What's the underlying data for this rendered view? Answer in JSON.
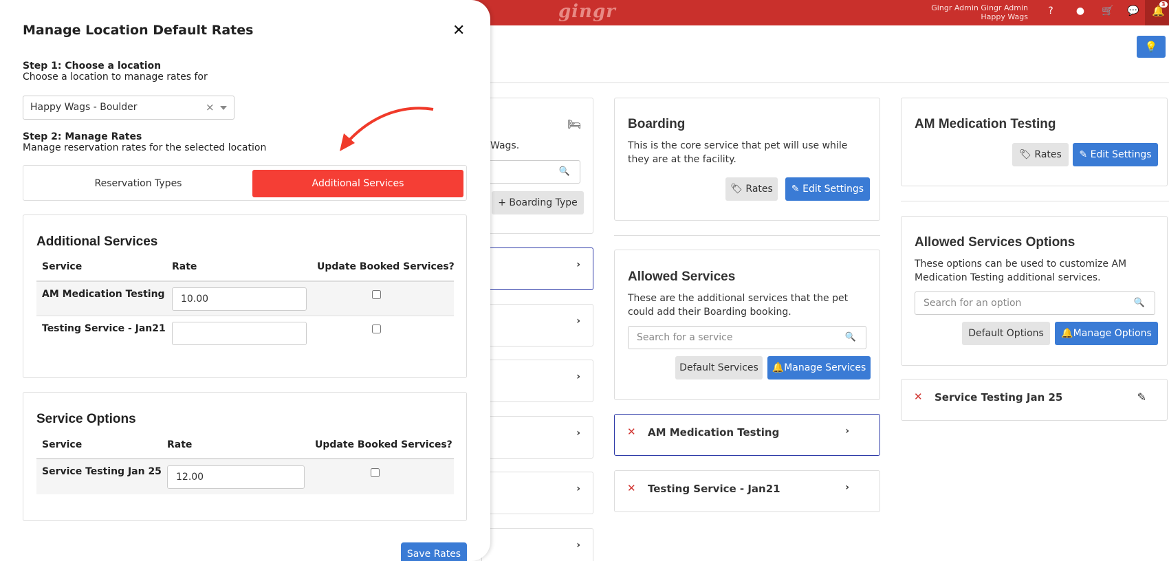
{
  "app": {
    "logo": "gingr",
    "user_name": "Gingr Admin Gingr Admin",
    "user_location": "Happy Wags",
    "notification_count": "3"
  },
  "background": {
    "wags_text": "Wags.",
    "boarding_type_button": "Boarding Type",
    "boarding_card": {
      "title": "Boarding",
      "description": "This is the core service that pet will use while they are at the facility.",
      "rates_button": "Rates",
      "edit_button": "Edit Settings"
    },
    "am_card": {
      "title": "AM Medication Testing",
      "rates_button": "Rates",
      "edit_button": "Edit Settings"
    },
    "allowed_services": {
      "title": "Allowed Services",
      "description": "These are the additional services that the pet could add their Boarding booking.",
      "search_placeholder": "Search for a service",
      "default_button": "Default Services",
      "manage_button": "Manage Services",
      "items": [
        "AM Medication Testing",
        "Testing Service - Jan21"
      ]
    },
    "allowed_options": {
      "title": "Allowed Services Options",
      "description": "These options can be used to customize AM Medication Testing additional services.",
      "search_placeholder": "Search for an option",
      "default_button": "Default Options",
      "manage_button": "Manage Options",
      "items": [
        "Service Testing Jan 25"
      ]
    }
  },
  "modal": {
    "title": "Manage Location Default Rates",
    "step1_title": "Step 1: Choose a location",
    "step1_desc": "Choose a location to manage rates for",
    "location_value": "Happy Wags - Boulder",
    "step2_title": "Step 2: Manage Rates",
    "step2_desc": "Manage reservation rates for the selected location",
    "tabs": [
      "Reservation Types",
      "Additional Services"
    ],
    "additional_services": {
      "heading": "Additional Services",
      "columns": [
        "Service",
        "Rate",
        "Update Booked Services?"
      ],
      "rows": [
        {
          "service": "AM Medication Testing",
          "rate": "10.00"
        },
        {
          "service": "Testing Service - Jan21",
          "rate": ""
        }
      ]
    },
    "service_options": {
      "heading": "Service Options",
      "columns": [
        "Service",
        "Rate",
        "Update Booked Services?"
      ],
      "rows": [
        {
          "service": "Service Testing Jan 25",
          "rate": "12.00"
        }
      ]
    },
    "save_button": "Save Rates"
  },
  "colors": {
    "topbar": "#c9302c",
    "active_tab": "#f53e35",
    "primary": "#3a7bd5",
    "selected_border": "#2d3aa8"
  }
}
